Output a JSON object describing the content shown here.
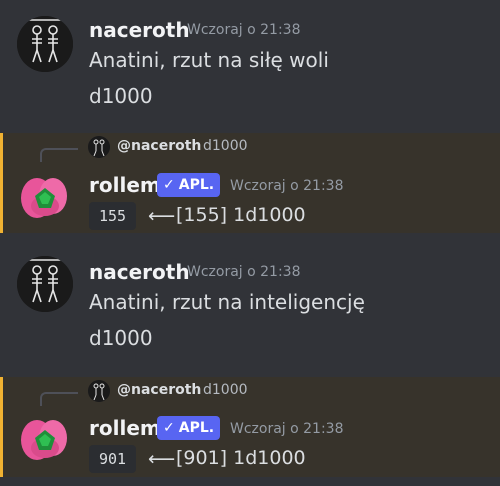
{
  "messages": [
    {
      "username": "naceroth",
      "timestamp": "Wczoraj o 21:38",
      "lines": [
        "Anatini, rzut na siłę woli",
        "d1000"
      ]
    },
    {
      "reply": {
        "user": "@naceroth",
        "text": "d1000"
      },
      "username": "rollem",
      "badge": {
        "check": "✓",
        "label": "APL."
      },
      "timestamp": "Wczoraj o 21:38",
      "result": {
        "value": "155",
        "arrow": "⟵",
        "text": "[155] 1d1000"
      }
    },
    {
      "username": "naceroth",
      "timestamp": "Wczoraj o 21:38",
      "lines": [
        "Anatini, rzut na inteligencję",
        "d1000"
      ]
    },
    {
      "reply": {
        "user": "@naceroth",
        "text": "d1000"
      },
      "username": "rollem",
      "badge": {
        "check": "✓",
        "label": "APL."
      },
      "timestamp": "Wczoraj o 21:38",
      "result": {
        "value": "901",
        "arrow": "⟵",
        "text": "[901] 1d1000"
      }
    }
  ],
  "colors": {
    "background": "#313338",
    "highlight": "#37332b",
    "mention_bar": "#f0b232",
    "badge": "#5865f2"
  }
}
